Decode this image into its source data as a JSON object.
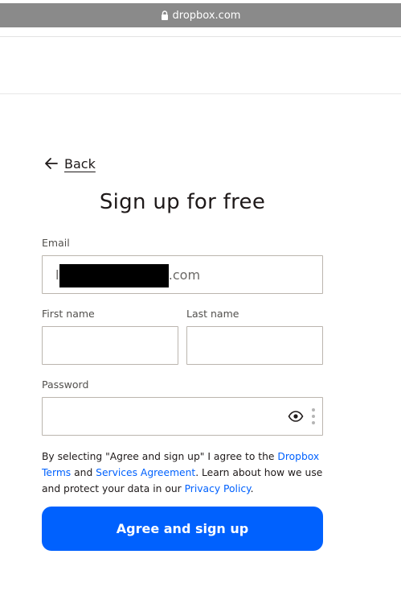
{
  "browser": {
    "url": "dropbox.com",
    "lock_icon": "lock-icon"
  },
  "nav": {
    "back_label": "Back",
    "back_icon": "arrow-left-icon"
  },
  "form": {
    "title": "Sign up for free",
    "email": {
      "label": "Email",
      "value_visible_prefix": "l",
      "value_visible_suffix": "s.com"
    },
    "first_name": {
      "label": "First name",
      "value": ""
    },
    "last_name": {
      "label": "Last name",
      "value": ""
    },
    "password": {
      "label": "Password",
      "value": "",
      "toggle_icon": "eye-icon",
      "extension_icon": "more-vertical-icon"
    }
  },
  "terms": {
    "text_1": "By selecting \"Agree and sign up\" I agree to the ",
    "link_dropbox_terms": "Dropbox Terms",
    "text_2": " and ",
    "link_services_agreement": "Services Agreement",
    "text_3": ". Learn about how we use and protect your data in our ",
    "link_privacy_policy": "Privacy Policy",
    "text_4": "."
  },
  "submit": {
    "label": "Agree and sign up"
  },
  "colors": {
    "brand_blue": "#0061fe",
    "url_bar": "#8a8a8a",
    "text": "#1e1919",
    "border": "#bbb5ae"
  }
}
